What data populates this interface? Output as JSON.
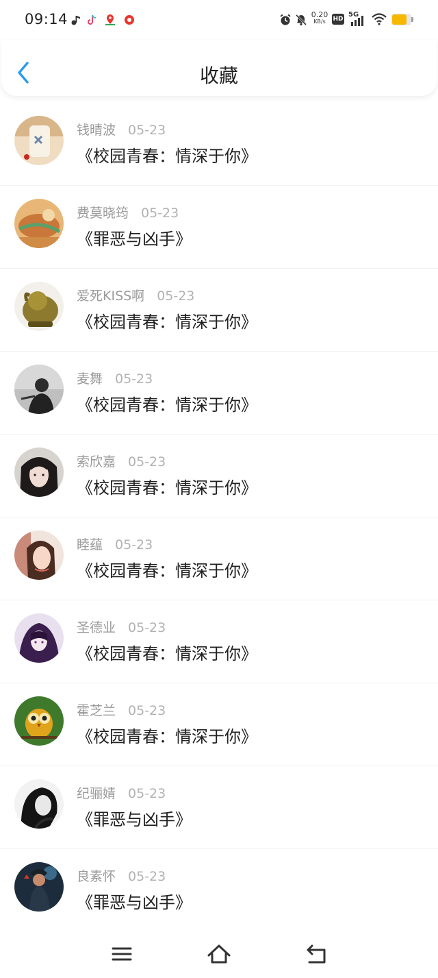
{
  "status_bar": {
    "time": "09:14",
    "net_speed_value": "0.20",
    "net_speed_unit": "KB/s",
    "hd": "HD",
    "signal": "5G",
    "icons": [
      "music-note-icon",
      "tiktok-icon",
      "maps-pin-icon",
      "video-app-icon",
      "alarm-icon",
      "bell-off-icon",
      "wifi-icon",
      "battery-icon"
    ],
    "battery_color": "#f6b800"
  },
  "header": {
    "title": "收藏",
    "accent_color": "#2b9bef"
  },
  "favorites": [
    {
      "name": "钱晴波",
      "date": "05-23",
      "work": "《校园青春：情深于你》"
    },
    {
      "name": "费莫晓筠",
      "date": "05-23",
      "work": "《罪恶与凶手》"
    },
    {
      "name": "爱死KISS啊",
      "date": "05-23",
      "work": "《校园青春：情深于你》"
    },
    {
      "name": "麦舞",
      "date": "05-23",
      "work": "《校园青春：情深于你》"
    },
    {
      "name": "索欣嘉",
      "date": "05-23",
      "work": "《校园青春：情深于你》"
    },
    {
      "name": "睦蕴",
      "date": "05-23",
      "work": "《校园青春：情深于你》"
    },
    {
      "name": "圣德业",
      "date": "05-23",
      "work": "《校园青春：情深于你》"
    },
    {
      "name": "霍芝兰",
      "date": "05-23",
      "work": "《校园青春：情深于你》"
    },
    {
      "name": "纪骊婧",
      "date": "05-23",
      "work": "《罪恶与凶手》"
    },
    {
      "name": "良素怀",
      "date": "05-23",
      "work": "《罪恶与凶手》"
    }
  ],
  "nav_bar": {
    "icons": [
      "menu-icon",
      "home-icon",
      "back-icon"
    ]
  }
}
